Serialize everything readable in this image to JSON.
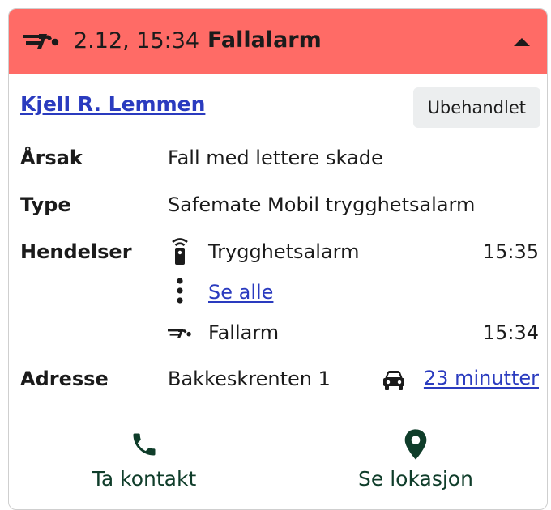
{
  "header": {
    "time": "2.12, 15:34",
    "title": "Fallalarm",
    "icon": "fall-icon",
    "color": "#ff6b66"
  },
  "person": {
    "name": "Kjell R. Lemmen",
    "status": "Ubehandlet"
  },
  "details": {
    "cause_label": "Årsak",
    "cause_value": "Fall med lettere skade",
    "type_label": "Type",
    "type_value": "Safemate Mobil trygghetsalarm",
    "events_label": "Hendelser",
    "events": [
      {
        "icon": "safety-alarm-icon",
        "text": "Trygghetsalarm",
        "time": "15:35"
      },
      {
        "icon": "more-vertical-icon",
        "text": "Se alle",
        "time": ""
      },
      {
        "icon": "fall-icon",
        "text": "Fallarm",
        "time": "15:34"
      }
    ],
    "address_label": "Adresse",
    "address_value": "Bakkeskrenten 1",
    "travel_icon": "car-icon",
    "travel_time": "23 minutter"
  },
  "actions": {
    "contact_label": "Ta kontakt",
    "location_label": "Se lokasjon"
  },
  "colors": {
    "link": "#2a3bbf",
    "action": "#0f3d2a",
    "badge_bg": "#eceeef"
  }
}
